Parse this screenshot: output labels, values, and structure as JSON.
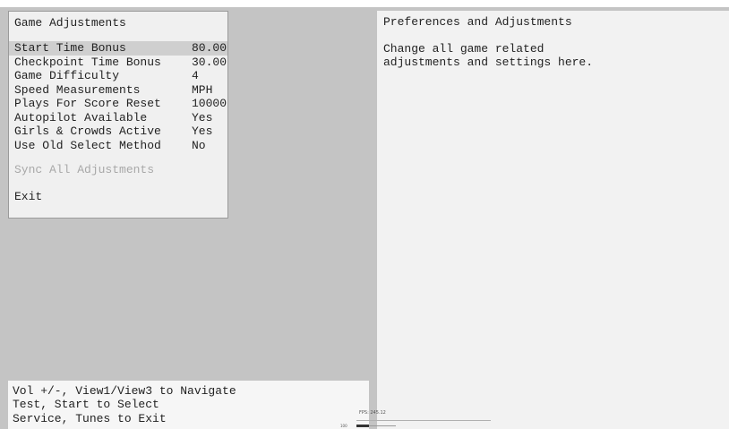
{
  "left_panel": {
    "title": "Game Adjustments",
    "items": [
      {
        "label": "Start Time Bonus",
        "value": "80.00"
      },
      {
        "label": "Checkpoint Time Bonus",
        "value": "30.00"
      },
      {
        "label": "Game Difficulty",
        "value": "4"
      },
      {
        "label": "Speed Measurements",
        "value": "MPH"
      },
      {
        "label": "Plays For Score Reset",
        "value": "10000"
      },
      {
        "label": "Autopilot Available",
        "value": "Yes"
      },
      {
        "label": "Girls & Crowds Active",
        "value": "Yes"
      },
      {
        "label": "Use Old Select Method",
        "value": "No"
      }
    ],
    "sync_label": "Sync All Adjustments",
    "exit_label": "Exit"
  },
  "right_panel": {
    "title": "Preferences and Adjustments",
    "description_line1": "Change all game related",
    "description_line2": "adjustments and settings here."
  },
  "help": {
    "line1": "Vol +/-, View1/View3 to Navigate",
    "line2": "Test, Start to Select",
    "line3": "Service, Tunes to Exit"
  },
  "debug": {
    "fps_text": "FPS: 245.12",
    "small_number": "100"
  },
  "colors": {
    "background": "#c4c4c4",
    "panel": "#f0f0f0",
    "selected_row": "#cfcfcf",
    "disabled_text": "#a8a8a8"
  }
}
